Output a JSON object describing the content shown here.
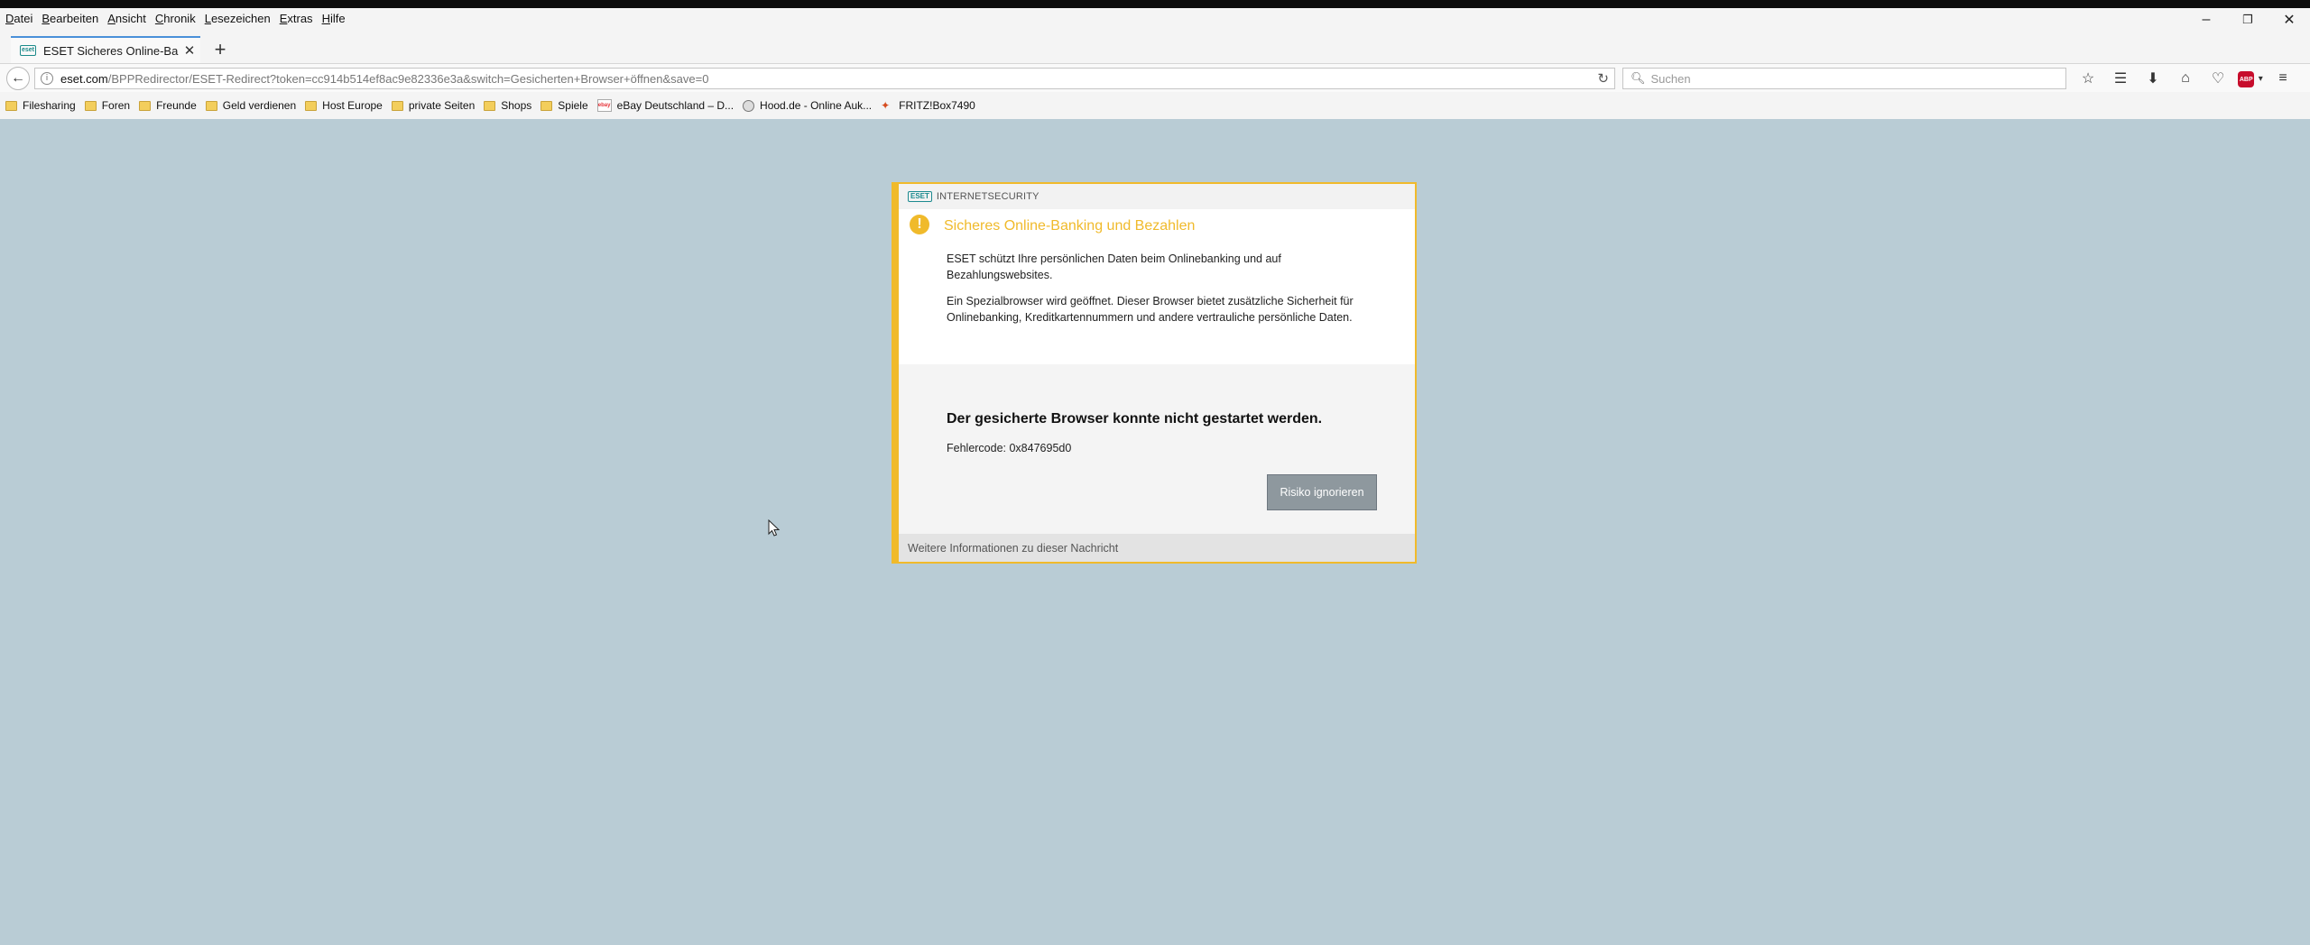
{
  "menu": {
    "items": [
      {
        "accel": "D",
        "rest": "atei"
      },
      {
        "accel": "B",
        "rest": "earbeiten"
      },
      {
        "accel": "A",
        "rest": "nsicht"
      },
      {
        "accel": "C",
        "rest": "hronik"
      },
      {
        "accel": "L",
        "rest": "esezeichen"
      },
      {
        "accel": "E",
        "rest": "xtras"
      },
      {
        "accel": "H",
        "rest": "ilfe"
      }
    ]
  },
  "window": {
    "minimize_icon": "minimize-icon",
    "restore_icon": "restore-icon",
    "close_icon": "close-icon"
  },
  "tab": {
    "title": "ESET Sicheres Online-Ban...",
    "favicon": "eset-favicon"
  },
  "urlbar": {
    "domain": "eset.com",
    "path": "/BPPRedirector/ESET-Redirect?token=cc914b514ef8ac9e82336e3a&switch=Gesicherten+Browser+öffnen&save=0"
  },
  "search": {
    "placeholder": "Suchen"
  },
  "bookmarks": [
    {
      "label": "Filesharing",
      "icon": "folder-icon"
    },
    {
      "label": "Foren",
      "icon": "folder-icon"
    },
    {
      "label": "Freunde",
      "icon": "folder-icon"
    },
    {
      "label": "Geld verdienen",
      "icon": "folder-icon"
    },
    {
      "label": "Host Europe",
      "icon": "folder-icon"
    },
    {
      "label": "private Seiten",
      "icon": "folder-icon"
    },
    {
      "label": "Shops",
      "icon": "folder-icon"
    },
    {
      "label": "Spiele",
      "icon": "folder-icon"
    },
    {
      "label": "eBay Deutschland – D...",
      "icon": "ebay-icon"
    },
    {
      "label": "Hood.de - Online Auk...",
      "icon": "hood-icon"
    },
    {
      "label": "FRITZ!Box7490",
      "icon": "fritz-icon"
    }
  ],
  "dialog": {
    "logo": "ESET",
    "product": "INTERNETSECURITY",
    "title": "Sicheres Online-Banking und Bezahlen",
    "para1": "ESET schützt Ihre persönlichen Daten beim Onlinebanking und auf Bezahlungswebsites.",
    "para2": "Ein Spezialbrowser wird geöffnet. Dieser Browser bietet zusätzliche Sicherheit für Onlinebanking, Kreditkartennummern und andere vertrauliche persönliche Daten.",
    "error_heading": "Der gesicherte Browser konnte nicht gestartet werden.",
    "error_code": "Fehlercode: 0x847695d0",
    "ignore_button": "Risiko ignorieren",
    "footer_link": "Weitere Informationen zu dieser Nachricht"
  },
  "colors": {
    "accent": "#f0ba2b",
    "page_background": "#b9ccd5",
    "eset_teal": "#1c8a8f",
    "button_gray": "#8e989e"
  }
}
